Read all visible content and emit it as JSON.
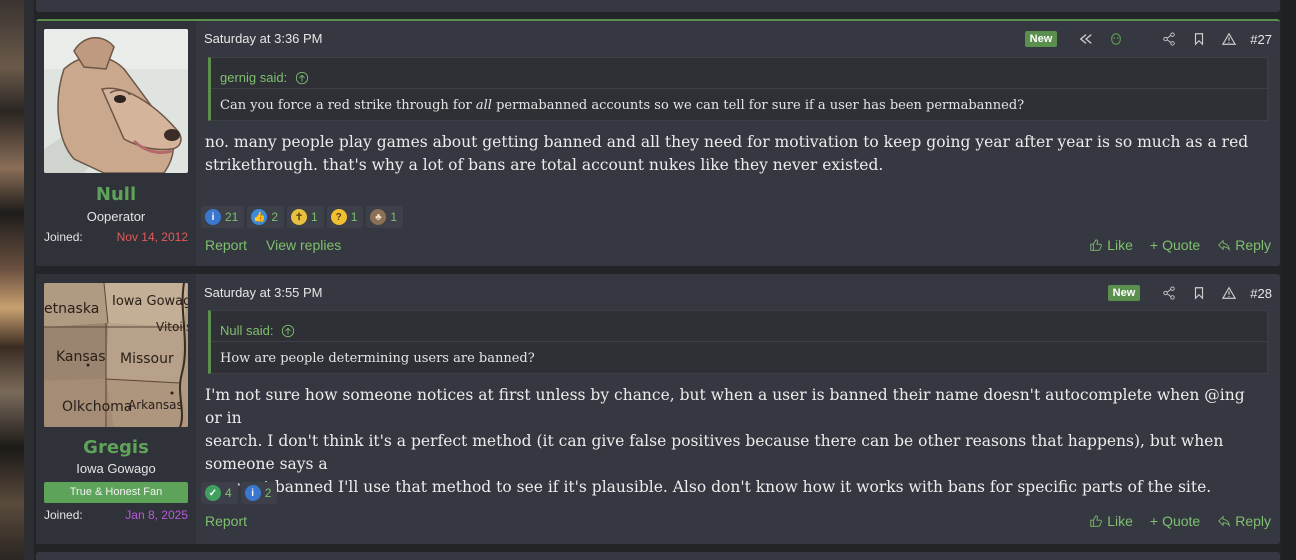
{
  "posts": [
    {
      "author": {
        "name": "Null",
        "title": "Ooperator",
        "joined_label": "Joined:",
        "joined": "Nov 14, 2012",
        "joined_color": "#e45a5a"
      },
      "date": "Saturday at 3:36 PM",
      "new_badge": "New",
      "number": "#27",
      "quote": {
        "author": "gernig said:",
        "text_before": "Can you force a red strike through for ",
        "text_italic": "all",
        "text_after": " permabanned accounts so we can tell for sure if a user has been permabanned?"
      },
      "body_lines": [
        "no. many people play games about getting banned and all they need for motivation to keep going year after year is so much as a red",
        "strikethrough. that's why a lot of bans are total account nukes like they never existed."
      ],
      "reactions": [
        {
          "icon": "informative-icon",
          "count": "21"
        },
        {
          "icon": "like-icon",
          "count": "2"
        },
        {
          "icon": "halo-icon",
          "count": "1"
        },
        {
          "icon": "thinking-icon",
          "count": "1"
        },
        {
          "icon": "mushroom-icon",
          "count": "1"
        }
      ],
      "footer_left": [
        "Report",
        "View replies"
      ],
      "footer_right": {
        "like": "Like",
        "quote": "Quote",
        "reply": "Reply"
      }
    },
    {
      "author": {
        "name": "Gregis",
        "title": "Iowa Gowago",
        "banner": "True & Honest Fan",
        "joined_label": "Joined:",
        "joined": "Jan 8, 2025",
        "joined_color": "#b85ad8"
      },
      "date": "Saturday at 3:55 PM",
      "new_badge": "New",
      "number": "#28",
      "quote": {
        "author": "Null said:",
        "text": "How are people determining users are banned?"
      },
      "body_lines": [
        "I'm not sure how someone notices at first unless by chance, but when a user is banned their name doesn't autocomplete when @ing or in",
        "search. I don't think it's a perfect method (it can give false positives because there can be other reasons that happens), but when someone says a",
        "user got banned I'll use that method to see if it's plausible. Also don't know how it works with bans for specific parts of the site."
      ],
      "reactions": [
        {
          "icon": "agree-icon",
          "count": "4"
        },
        {
          "icon": "informative-icon",
          "count": "2"
        }
      ],
      "footer_left": [
        "Report"
      ],
      "footer_right": {
        "like": "Like",
        "quote": "Quote",
        "reply": "Reply"
      }
    }
  ],
  "avatar2_map_labels": [
    "etnaska",
    "Iowa Gowago",
    "Vitoiis",
    "Kansas",
    "Missour",
    "Olkchoma",
    "Arkansas"
  ],
  "colors": {
    "accent_green": "#5a8f4e",
    "link_green": "#7fbf6f",
    "post_bg": "#353840"
  }
}
